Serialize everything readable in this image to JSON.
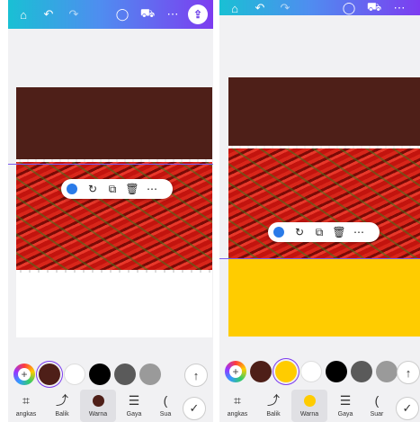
{
  "colors": {
    "brown": "#4e1f18",
    "yellow": "#ffcc00",
    "gradient": [
      "#19c0d4",
      "#7d3cf0"
    ],
    "guide": "#7b5cf0"
  },
  "toolbar": {
    "icons": [
      "home-icon",
      "undo-icon",
      "redo-icon",
      "comment-icon",
      "truck-icon",
      "more-icon",
      "share-icon"
    ]
  },
  "context_menu": {
    "icons": [
      "color-dot-icon",
      "rotate-icon",
      "duplicate-icon",
      "trash-icon",
      "more-icon"
    ]
  },
  "left": {
    "swatches": [
      "#4e1f18",
      "#ffffff",
      "#000000",
      "#5a5a5a",
      "#9a9a9a"
    ],
    "tabs": [
      {
        "label": "angkas",
        "icon": "crop-icon"
      },
      {
        "label": "Balik",
        "icon": "flip-icon"
      },
      {
        "label": "Warna",
        "icon": "color-icon",
        "color": "#4e1f18"
      },
      {
        "label": "Gaya",
        "icon": "lines-icon"
      },
      {
        "label": "Sua",
        "icon": "sound-icon"
      }
    ]
  },
  "right": {
    "swatches": [
      "#4e1f18",
      "#ffcc00",
      "#ffffff",
      "#000000",
      "#5a5a5a",
      "#9a9a9a"
    ],
    "tabs": [
      {
        "label": "angkas",
        "icon": "crop-icon"
      },
      {
        "label": "Balik",
        "icon": "flip-icon"
      },
      {
        "label": "Warna",
        "icon": "color-icon",
        "color": "#ffcc00"
      },
      {
        "label": "Gaya",
        "icon": "lines-icon"
      },
      {
        "label": "Suar",
        "icon": "sound-icon"
      }
    ]
  }
}
